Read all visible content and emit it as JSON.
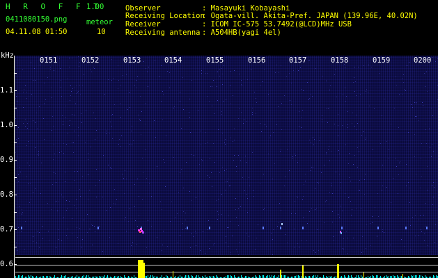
{
  "header": {
    "app_title": "H R O F F T",
    "version": "1.00",
    "filename": "0411080150.png",
    "datetime": "04.11.08 01:50",
    "meteor_label": "meteor",
    "meteor_count": "10"
  },
  "info": {
    "observer_label": "Observer",
    "observer_value": ": Masayuki Kobayashi",
    "location_label": "Receiving Location",
    "location_value": ": Ogata-vill. Akita-Pref. JAPAN (139.96E, 40.02N)",
    "receiver_label": "Receiver",
    "receiver_value": ": ICOM IC-575 53.7492(@LCD)MHz USB",
    "antenna_label": "Receiving antenna",
    "antenna_value": ": A504HB(yagi 4el)"
  },
  "axis": {
    "unit": "kHz",
    "time_labels": [
      "0151",
      "0152",
      "0153",
      "0154",
      "0155",
      "0156",
      "0157",
      "0158",
      "0159",
      "0200"
    ],
    "freq_labels": [
      "1.1",
      "1.0",
      "0.9",
      "0.8",
      "0.7",
      "0.6"
    ]
  },
  "colors": {
    "text_green": "#33ff33",
    "text_yellow": "#ffff00",
    "signal_yellow": "#ffff00",
    "echo_magenta": "#ff33ff",
    "noise_cyan": "#00ffff"
  }
}
